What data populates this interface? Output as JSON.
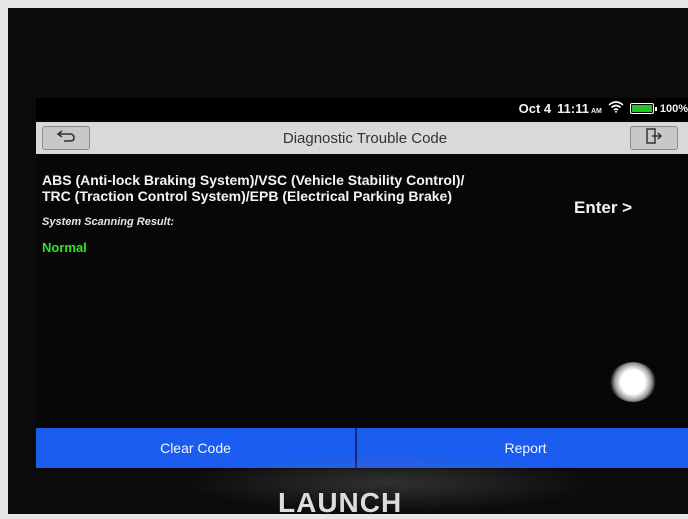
{
  "statusbar": {
    "date": "Oct 4",
    "time": "11:11",
    "ampm": "AM",
    "battery": "100%",
    "battery_color": "#21c521"
  },
  "header": {
    "title": "Diagnostic Trouble Code",
    "back_icon": "back-arrow-icon",
    "exit_icon": "exit-door-icon"
  },
  "system": {
    "name_line1": "ABS (Anti-lock Braking System)/VSC (Vehicle Stability Control)/",
    "name_line2": "TRC (Traction Control System)/EPB (Electrical Parking Brake)",
    "scan_label": "System Scanning Result:",
    "result": "Normal",
    "result_color": "#2fe22f",
    "enter_label": "Enter >"
  },
  "bottom": {
    "clear_label": "Clear Code",
    "report_label": "Report",
    "bar_color": "#1a5cf0"
  },
  "device": {
    "brand": "LAUNCH"
  }
}
